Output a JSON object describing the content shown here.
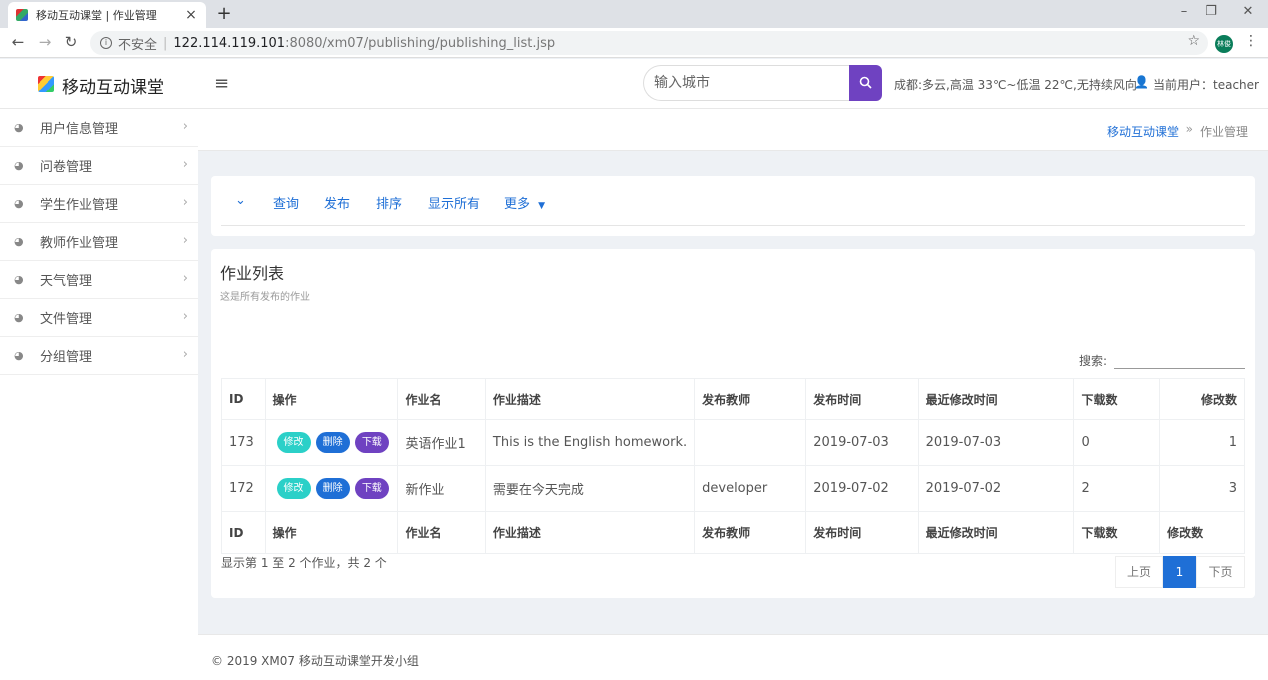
{
  "browser": {
    "tab_title": "移动互动课堂 | 作业管理",
    "new_tab": "+",
    "close": "×",
    "minimize": "–",
    "restore": "❐",
    "close_window": "✕",
    "insecure_label": "不安全",
    "url_host": "122.114.119.101",
    "url_rest": ":8080/xm07/publishing/publishing_list.jsp",
    "profile_initials": "林俊"
  },
  "header": {
    "app_name": "移动互动课堂",
    "city_placeholder": "输入城市",
    "weather": "成都:多云,高温 33℃~低温 22℃,无持续风向",
    "user_label": "当前用户：teacher"
  },
  "sidebar": {
    "items": [
      {
        "label": "用户信息管理"
      },
      {
        "label": "问卷管理"
      },
      {
        "label": "学生作业管理"
      },
      {
        "label": "教师作业管理"
      },
      {
        "label": "天气管理"
      },
      {
        "label": "文件管理"
      },
      {
        "label": "分组管理"
      }
    ]
  },
  "breadcrumb": {
    "home": "移动互动课堂",
    "separator": "»",
    "current": "作业管理"
  },
  "toolbar": {
    "query": "查询",
    "publish": "发布",
    "sort": "排序",
    "show_all": "显示所有",
    "more": "更多"
  },
  "list": {
    "title": "作业列表",
    "subtitle": "这是所有发布的作业",
    "search_label": "搜索:",
    "columns": [
      "ID",
      "操作",
      "作业名",
      "作业描述",
      "发布教师",
      "发布时间",
      "最近修改时间",
      "下载数",
      "修改数"
    ],
    "op_labels": {
      "edit": "修改",
      "delete": "删除",
      "download": "下载"
    },
    "rows": [
      {
        "id": "173",
        "name": "英语作业1",
        "desc": "This is the English homework.",
        "teacher": "",
        "published": "2019-07-03",
        "modified": "2019-07-03",
        "downloads": "0",
        "edits": "1"
      },
      {
        "id": "172",
        "name": "新作业",
        "desc": "需要在今天完成",
        "teacher": "developer",
        "published": "2019-07-02",
        "modified": "2019-07-02",
        "downloads": "2",
        "edits": "3"
      }
    ],
    "info": "显示第 1 至 2 个作业，共 2 个",
    "pager": {
      "prev": "上页",
      "current": "1",
      "next": "下页"
    }
  },
  "footer": {
    "text": "© 2019 XM07 移动互动课堂开发小组"
  }
}
